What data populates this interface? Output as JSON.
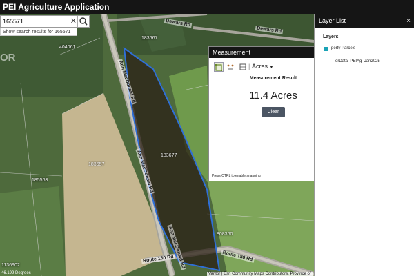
{
  "app": {
    "title": "PEI Agriculture Application"
  },
  "search": {
    "value": "165571",
    "suggestion": "Show search results for 165571"
  },
  "map": {
    "parcel_labels": [
      "183667",
      "404061",
      "183657",
      "185563",
      "183677",
      "808360",
      "1136902"
    ],
    "road_labels": [
      "Dewars Rd",
      "Dewars Rd",
      "Ann MacDonald Rd",
      "Ann MacDonald Rd",
      "Ann MacDonald Rd",
      "Route 180 Rd",
      "Route 180 Rd"
    ],
    "coords_text": "46.199 Degrees",
    "attribution": "Vantor | Esri Community Maps Contributors, Province of",
    "watermark": "OR",
    "colors": {
      "selected_outline": "#2f6fd8",
      "selected_fill": "#2b2016"
    }
  },
  "measurement": {
    "title": "Measurement",
    "close_icon": "×",
    "unit": "Acres",
    "result_label": "Measurement Result",
    "result_value": "11.4 Acres",
    "clear_label": "Clear",
    "snap_hint": "Press CTRL to enable snapping"
  },
  "layer_list": {
    "title": "Layer List",
    "close_icon": "×",
    "section": "Layers",
    "items": [
      "perty Parcels",
      "orData_PEIAg_Jan2025"
    ]
  }
}
